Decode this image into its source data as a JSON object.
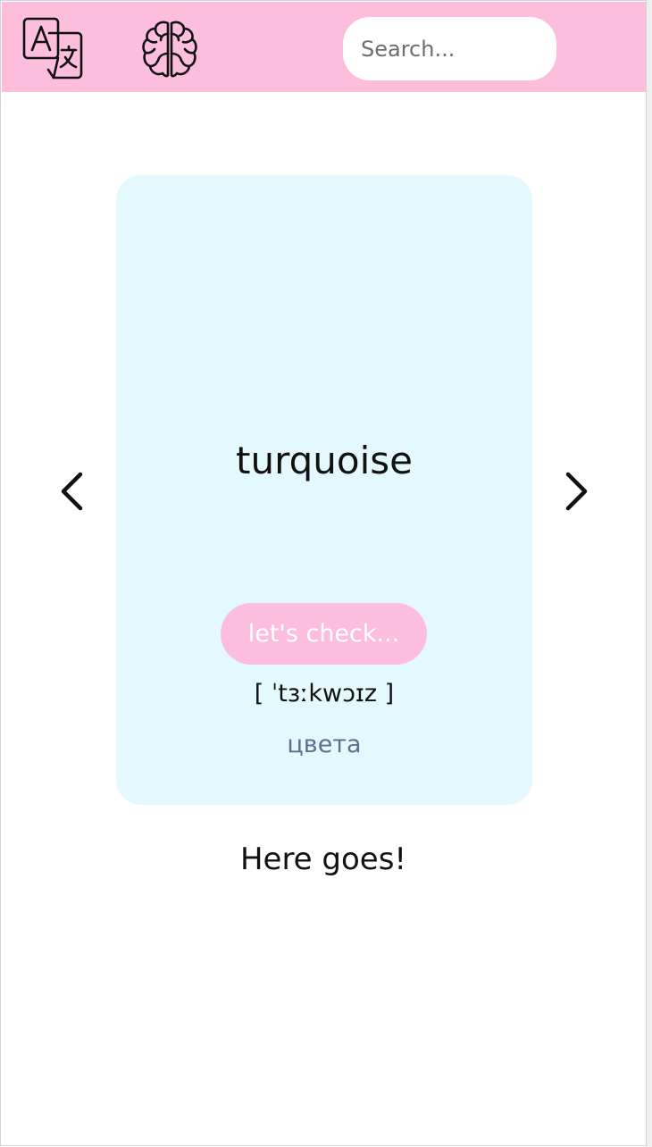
{
  "header": {
    "translate_icon": "translate-icon",
    "brain_icon": "brain-icon",
    "search_placeholder": "Search...",
    "search_value": ""
  },
  "card": {
    "word": "turquoise",
    "transcription": "[ ˈtɜːkwɔɪz ]",
    "check_label": "let's check...",
    "category": "цвета"
  },
  "nav": {
    "prev_icon": "chevron-left-icon",
    "next_icon": "chevron-right-icon"
  },
  "message": "Here goes!",
  "colors": {
    "header_bg": "#fdbddc",
    "card_bg": "#e4f9fd",
    "button_bg": "#fdbddc",
    "category_text": "#5c6f8e"
  }
}
